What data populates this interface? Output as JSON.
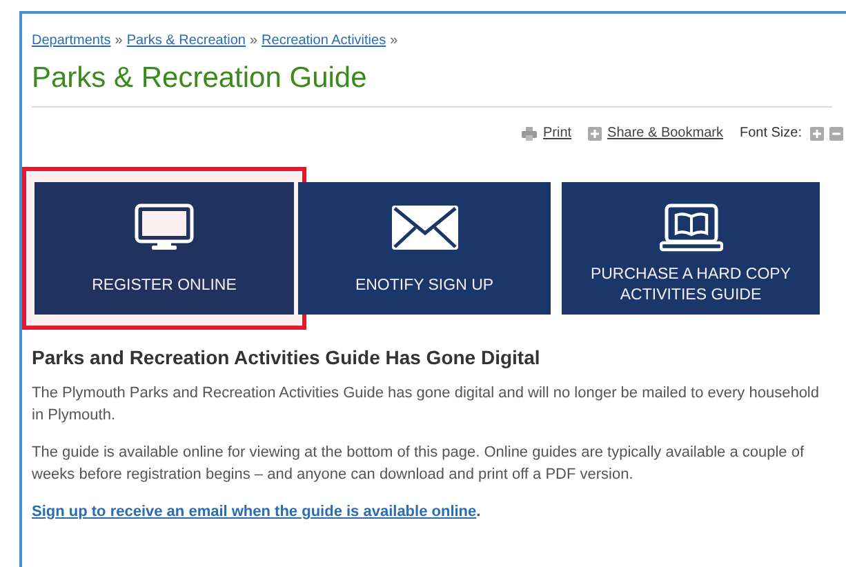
{
  "breadcrumb": [
    {
      "label": "Departments"
    },
    {
      "label": "Parks & Recreation"
    },
    {
      "label": "Recreation Activities"
    }
  ],
  "breadcrumb_separator": "»",
  "title": "Parks & Recreation Guide",
  "tools": {
    "print": "Print",
    "share": "Share & Bookmark",
    "font_size": "Font Size:"
  },
  "tiles": [
    {
      "kind": "monitor",
      "label": "REGISTER ONLINE",
      "selected": true
    },
    {
      "kind": "envelope",
      "label": "ENOTIFY SIGN UP",
      "selected": false
    },
    {
      "kind": "book",
      "label": "PURCHASE A HARD COPY ACTIVITIES GUIDE",
      "selected": false
    }
  ],
  "heading": "Parks and Recreation Activities Guide Has Gone Digital",
  "paragraphs": [
    {
      "kind": "text",
      "text": "The Plymouth Parks and Recreation Activities Guide has gone digital and will no longer be mailed to every household in Plymouth."
    },
    {
      "kind": "text",
      "text": "The guide is available online for viewing at the bottom of this page. Online guides are typically available a couple of weeks before registration begins – and anyone can download and print off a PDF version."
    },
    {
      "kind": "link",
      "link": "Sign up to receive an email when the guide is available online",
      "after": "."
    }
  ]
}
